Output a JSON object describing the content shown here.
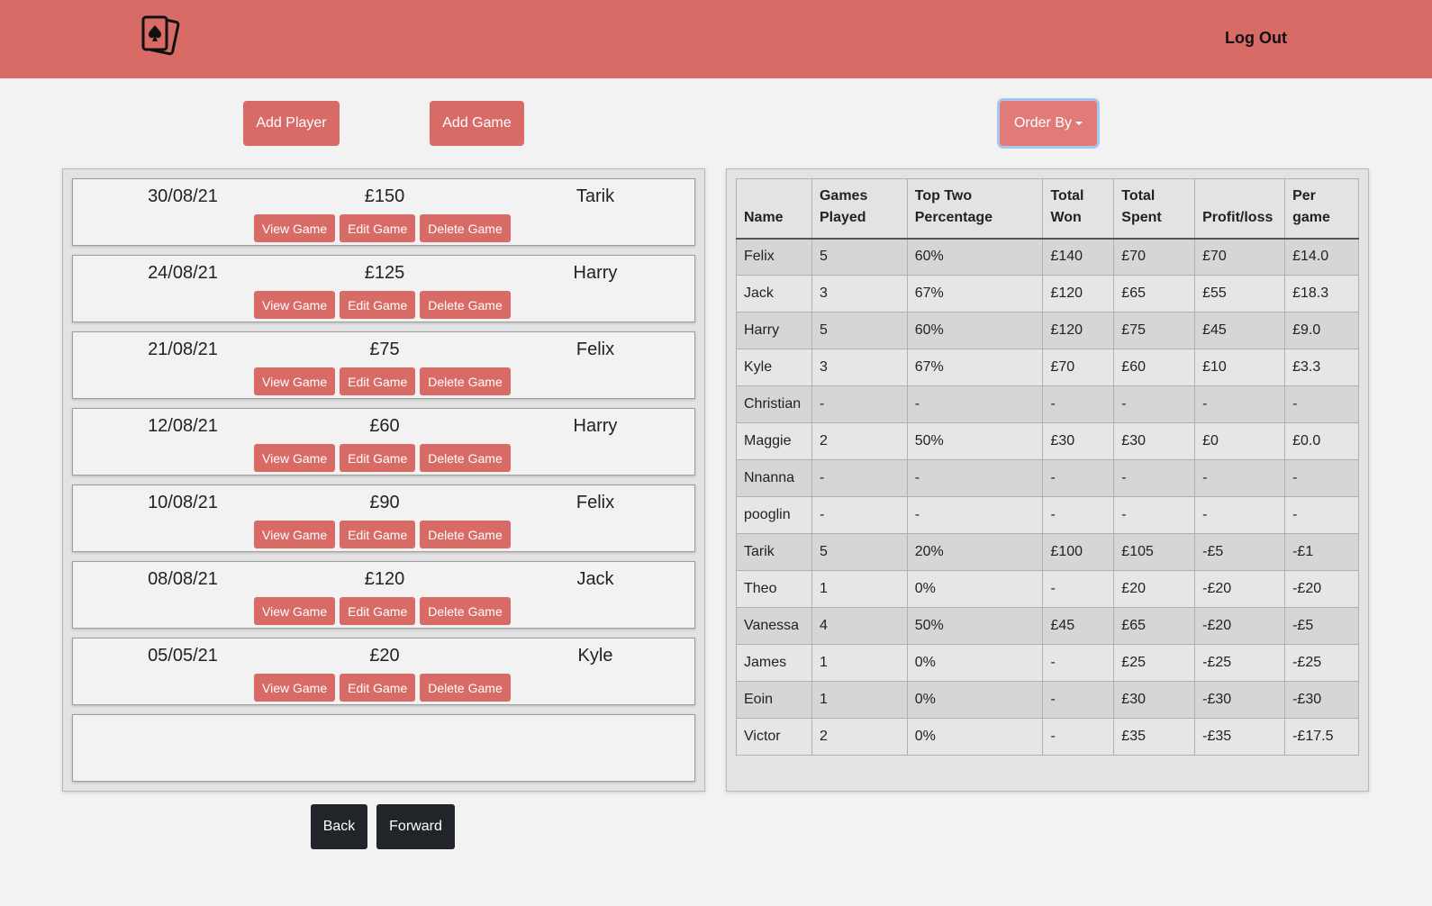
{
  "header": {
    "logout_label": "Log Out",
    "logo_icon": "playing-cards-icon"
  },
  "toolbar": {
    "add_player_label": "Add Player",
    "add_game_label": "Add Game",
    "order_by_label": "Order By"
  },
  "games": [
    {
      "date": "30/08/21",
      "amount": "£150",
      "winner": "Tarik"
    },
    {
      "date": "24/08/21",
      "amount": "£125",
      "winner": "Harry"
    },
    {
      "date": "21/08/21",
      "amount": "£75",
      "winner": "Felix"
    },
    {
      "date": "12/08/21",
      "amount": "£60",
      "winner": "Harry"
    },
    {
      "date": "10/08/21",
      "amount": "£90",
      "winner": "Felix"
    },
    {
      "date": "08/08/21",
      "amount": "£120",
      "winner": "Jack"
    },
    {
      "date": "05/05/21",
      "amount": "£20",
      "winner": "Kyle"
    }
  ],
  "game_actions": {
    "view_label": "View Game",
    "edit_label": "Edit Game",
    "delete_label": "Delete Game"
  },
  "pagination": {
    "back_label": "Back",
    "forward_label": "Forward"
  },
  "stats": {
    "headers": [
      "Name",
      "Games Played",
      "Top Two Percentage",
      "Total Won",
      "Total Spent",
      "Profit/loss",
      "Per game"
    ],
    "rows": [
      [
        "Felix",
        "5",
        "60%",
        "£140",
        "£70",
        "£70",
        "£14.0"
      ],
      [
        "Jack",
        "3",
        "67%",
        "£120",
        "£65",
        "£55",
        "£18.3"
      ],
      [
        "Harry",
        "5",
        "60%",
        "£120",
        "£75",
        "£45",
        "£9.0"
      ],
      [
        "Kyle",
        "3",
        "67%",
        "£70",
        "£60",
        "£10",
        "£3.3"
      ],
      [
        "Christian",
        "-",
        "-",
        "-",
        "-",
        "-",
        "-"
      ],
      [
        "Maggie",
        "2",
        "50%",
        "£30",
        "£30",
        "£0",
        "£0.0"
      ],
      [
        "Nnanna",
        "-",
        "-",
        "-",
        "-",
        "-",
        "-"
      ],
      [
        "pooglin",
        "-",
        "-",
        "-",
        "-",
        "-",
        "-"
      ],
      [
        "Tarik",
        "5",
        "20%",
        "£100",
        "£105",
        "-£5",
        "-£1"
      ],
      [
        "Theo",
        "1",
        "0%",
        "-",
        "£20",
        "-£20",
        "-£20"
      ],
      [
        "Vanessa",
        "4",
        "50%",
        "£45",
        "£65",
        "-£20",
        "-£5"
      ],
      [
        "James",
        "1",
        "0%",
        "-",
        "£25",
        "-£25",
        "-£25"
      ],
      [
        "Eoin",
        "1",
        "0%",
        "-",
        "£30",
        "-£30",
        "-£30"
      ],
      [
        "Victor",
        "2",
        "0%",
        "-",
        "£35",
        "-£35",
        "-£17.5"
      ]
    ]
  },
  "colors": {
    "brand": "#d96b66",
    "page_bg": "#f2f2f2",
    "dark_button": "#212529"
  }
}
